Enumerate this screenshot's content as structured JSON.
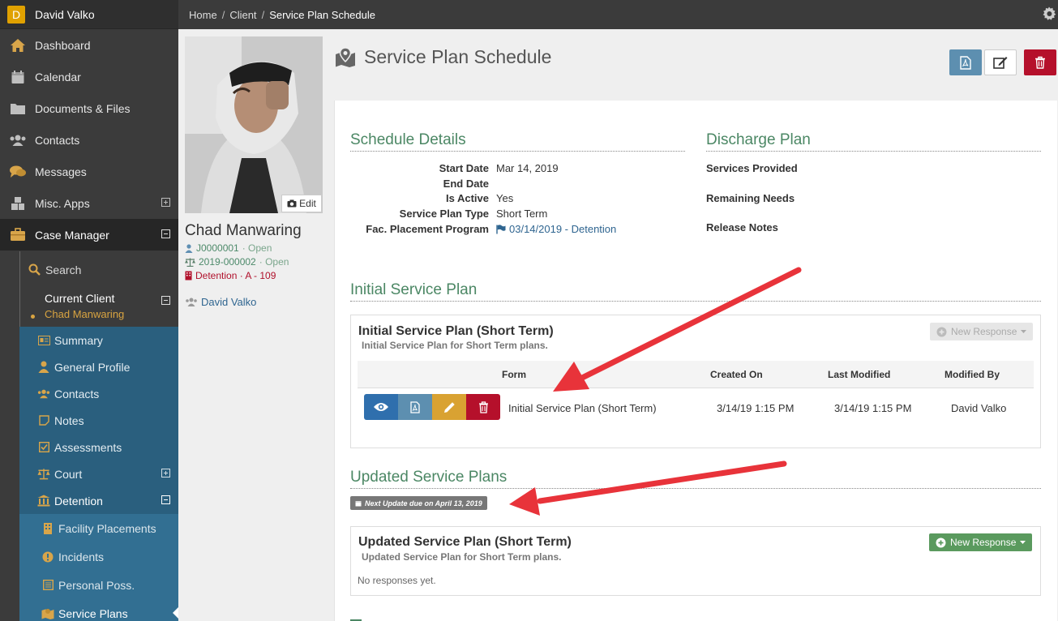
{
  "user": {
    "initial": "D",
    "name": "David Valko"
  },
  "sidebar": {
    "items": [
      {
        "label": "Dashboard",
        "icon": "home-icon"
      },
      {
        "label": "Calendar",
        "icon": "calendar-icon"
      },
      {
        "label": "Documents & Files",
        "icon": "folder-icon"
      },
      {
        "label": "Contacts",
        "icon": "users-icon"
      },
      {
        "label": "Messages",
        "icon": "chat-icon"
      },
      {
        "label": "Misc. Apps",
        "icon": "cubes-icon"
      },
      {
        "label": "Case Manager",
        "icon": "briefcase-icon"
      }
    ],
    "search_label": "Search",
    "current_client_label": "Current Client",
    "current_client_name": "Chad Manwaring",
    "client_items": [
      {
        "label": "Summary",
        "icon": "id-card-icon"
      },
      {
        "label": "General Profile",
        "icon": "user-icon"
      },
      {
        "label": "Contacts",
        "icon": "users-icon"
      },
      {
        "label": "Notes",
        "icon": "note-icon"
      },
      {
        "label": "Assessments",
        "icon": "checkbox-icon"
      },
      {
        "label": "Court",
        "icon": "scales-icon"
      },
      {
        "label": "Detention",
        "icon": "building-icon"
      }
    ],
    "detention_items": [
      {
        "label": "Facility Placements",
        "icon": "building-icon"
      },
      {
        "label": "Incidents",
        "icon": "alert-icon"
      },
      {
        "label": "Personal Poss.",
        "icon": "list-icon"
      },
      {
        "label": "Service Plans",
        "icon": "map-icon"
      }
    ]
  },
  "breadcrumb": {
    "items": [
      "Home",
      "Client",
      "Service Plan Schedule"
    ],
    "sep": "/"
  },
  "profile": {
    "edit_label": "Edit",
    "name": "Chad Manwaring",
    "case_id": "J0000001",
    "case_status": "· Open",
    "court_id": "2019-000002",
    "court_status": "· Open",
    "detention": "Detention · A - 109",
    "worker": "David Valko"
  },
  "page": {
    "title": "Service Plan Schedule"
  },
  "colors": {
    "accent_green": "#4b8764",
    "danger": "#b5102b",
    "link": "#2f6590",
    "pdf_btn": "#5d8fb0",
    "edit_btn": "#d9a232",
    "view_btn": "#2f6fad"
  },
  "schedule": {
    "title": "Schedule Details",
    "rows": [
      {
        "label": "Start Date",
        "value": "Mar 14, 2019"
      },
      {
        "label": "End Date",
        "value": ""
      },
      {
        "label": "Is Active",
        "value": "Yes"
      },
      {
        "label": "Service Plan Type",
        "value": "Short Term"
      },
      {
        "label": "Fac. Placement Program",
        "value": "03/14/2019 - Detention"
      }
    ]
  },
  "discharge": {
    "title": "Discharge Plan",
    "labels": [
      "Services Provided",
      "Remaining Needs",
      "Release Notes"
    ]
  },
  "initial_plan": {
    "section_title": "Initial Service Plan",
    "card_title": "Initial Service Plan (Short Term)",
    "card_sub": "Initial Service Plan for Short Term plans.",
    "new_response": "New Response",
    "columns": [
      "Form",
      "Created On",
      "Last Modified",
      "Modified By"
    ],
    "rows": [
      {
        "form": "Initial Service Plan (Short Term)",
        "created": "3/14/19 1:15 PM",
        "modified": "3/14/19 1:15 PM",
        "by": "David Valko"
      }
    ]
  },
  "updated_plans": {
    "section_title": "Updated Service Plans",
    "badge": "Next Update due on April 13, 2019",
    "card_title": "Updated Service Plan (Short Term)",
    "card_sub": "Updated Service Plan for Short Term plans.",
    "new_response": "New Response",
    "empty": "No responses yet."
  }
}
